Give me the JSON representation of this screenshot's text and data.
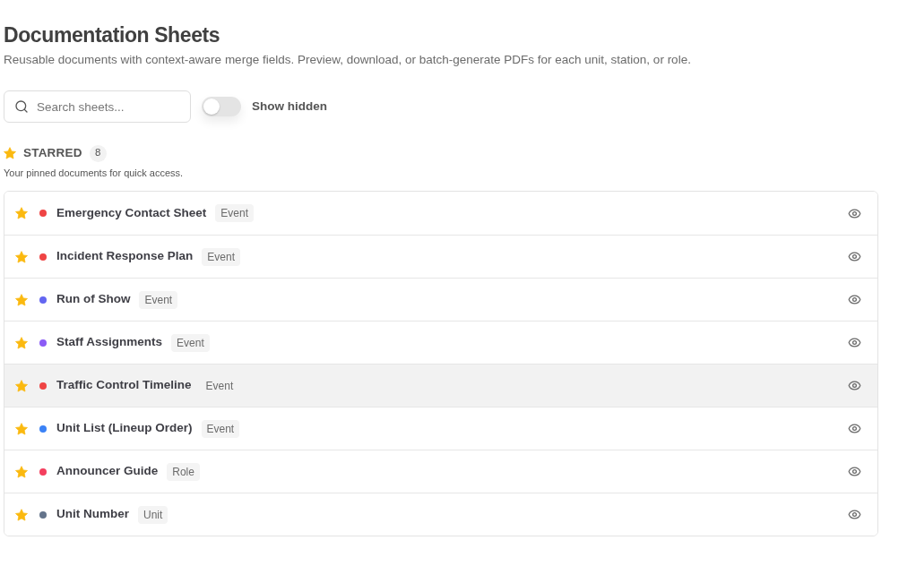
{
  "header": {
    "title": "Documentation Sheets",
    "description": "Reusable documents with context-aware merge fields. Preview, download, or batch-generate PDFs for each unit, station, or role."
  },
  "search": {
    "placeholder": "Search sheets..."
  },
  "show_hidden": {
    "label": "Show hidden",
    "on": false
  },
  "section": {
    "title": "STARRED",
    "count": "8",
    "description": "Your pinned documents for quick access."
  },
  "rows": [
    {
      "name": "Emergency Contact Sheet",
      "tag": "Event",
      "color": "#ef4444",
      "starred": true,
      "highlighted": false
    },
    {
      "name": "Incident Response Plan",
      "tag": "Event",
      "color": "#ef4444",
      "starred": true,
      "highlighted": false
    },
    {
      "name": "Run of Show",
      "tag": "Event",
      "color": "#6366f1",
      "starred": true,
      "highlighted": false
    },
    {
      "name": "Staff Assignments",
      "tag": "Event",
      "color": "#8b5cf6",
      "starred": true,
      "highlighted": false
    },
    {
      "name": "Traffic Control Timeline",
      "tag": "Event",
      "color": "#ef4444",
      "starred": true,
      "highlighted": true
    },
    {
      "name": "Unit List (Lineup Order)",
      "tag": "Event",
      "color": "#3b82f6",
      "starred": true,
      "highlighted": false
    },
    {
      "name": "Announcer Guide",
      "tag": "Role",
      "color": "#f43f5e",
      "starred": true,
      "highlighted": false
    },
    {
      "name": "Unit Number",
      "tag": "Unit",
      "color": "#64748b",
      "starred": true,
      "highlighted": false
    }
  ]
}
